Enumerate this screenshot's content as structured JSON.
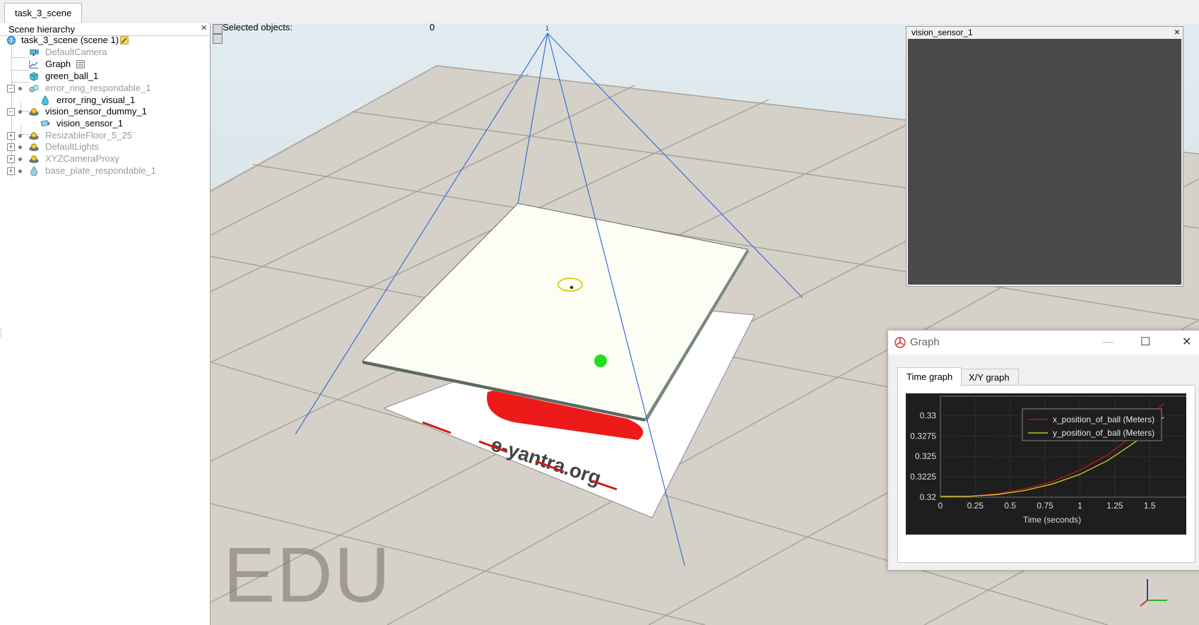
{
  "tabs": [
    {
      "label": "task_3_scene"
    }
  ],
  "hierarchy": {
    "title": "Scene hierarchy",
    "close_glyph": "×",
    "items": [
      {
        "label": "task_3_scene (scene 1)",
        "icon": "scene-globe-icon",
        "dim": false
      },
      {
        "label": "DefaultCamera",
        "icon": "camera-icon",
        "dim": true
      },
      {
        "label": "Graph",
        "icon": "graph-icon",
        "dim": false
      },
      {
        "label": "green_ball_1",
        "icon": "shape-icon",
        "dim": false
      },
      {
        "label": "error_ring_respondable_1",
        "icon": "shape-multi-icon",
        "dim": true
      },
      {
        "label": "error_ring_visual_1",
        "icon": "shape-drop-icon",
        "dim": false
      },
      {
        "label": "vision_sensor_dummy_1",
        "icon": "dummy-icon",
        "dim": false
      },
      {
        "label": "vision_sensor_1",
        "icon": "vision-sensor-icon",
        "dim": false
      },
      {
        "label": "ResizableFloor_5_25",
        "icon": "model-icon",
        "dim": true
      },
      {
        "label": "DefaultLights",
        "icon": "model-icon",
        "dim": true
      },
      {
        "label": "XYZCameraProxy",
        "icon": "model-icon",
        "dim": true
      },
      {
        "label": "base_plate_respondable_1",
        "icon": "shape-drop-icon",
        "dim": true
      }
    ]
  },
  "viewport": {
    "selected_label": "Selected objects:",
    "selected_count": "0",
    "watermark": "EDU",
    "floor_text": "e-yantra.org",
    "sensor_tag": "1"
  },
  "vision_sensor_window": {
    "title": "vision_sensor_1",
    "close_glyph": "×"
  },
  "graph_window": {
    "title": "Graph",
    "minimize_glyph": "—",
    "maximize_glyph": "☐",
    "close_glyph": "✕",
    "tabs": [
      {
        "label": "Time graph",
        "active": true
      },
      {
        "label": "X/Y graph",
        "active": false
      }
    ]
  },
  "colors": {
    "x_series": "#d01818",
    "y_series": "#e0e020",
    "plot_bg": "#1e1e1e",
    "frustum": "#3a6fd8"
  },
  "chart_data": {
    "type": "line",
    "xlabel": "Time (seconds)",
    "x_ticks": [
      "0",
      "0.25",
      "0.5",
      "0.75",
      "1",
      "1.25",
      "1.5"
    ],
    "y_ticks": [
      "0.32",
      "0.3225",
      "0.325",
      "0.3275",
      "0.33"
    ],
    "xlim": [
      0,
      1.6
    ],
    "ylim": [
      0.32,
      0.3315
    ],
    "grid": true,
    "legend_position": "top-right",
    "series": [
      {
        "name": "x_position_of_ball (Meters)",
        "x": [
          0,
          0.2,
          0.4,
          0.6,
          0.8,
          1.0,
          1.2,
          1.4,
          1.6
        ],
        "values": [
          0.3201,
          0.3201,
          0.3204,
          0.321,
          0.3219,
          0.3233,
          0.3252,
          0.3278,
          0.3315
        ]
      },
      {
        "name": "y_position_of_ball (Meters)",
        "x": [
          0,
          0.2,
          0.4,
          0.6,
          0.8,
          1.0,
          1.2,
          1.4,
          1.6
        ],
        "values": [
          0.3201,
          0.3201,
          0.3203,
          0.3208,
          0.3216,
          0.3228,
          0.3245,
          0.3268,
          0.3298
        ]
      }
    ]
  }
}
